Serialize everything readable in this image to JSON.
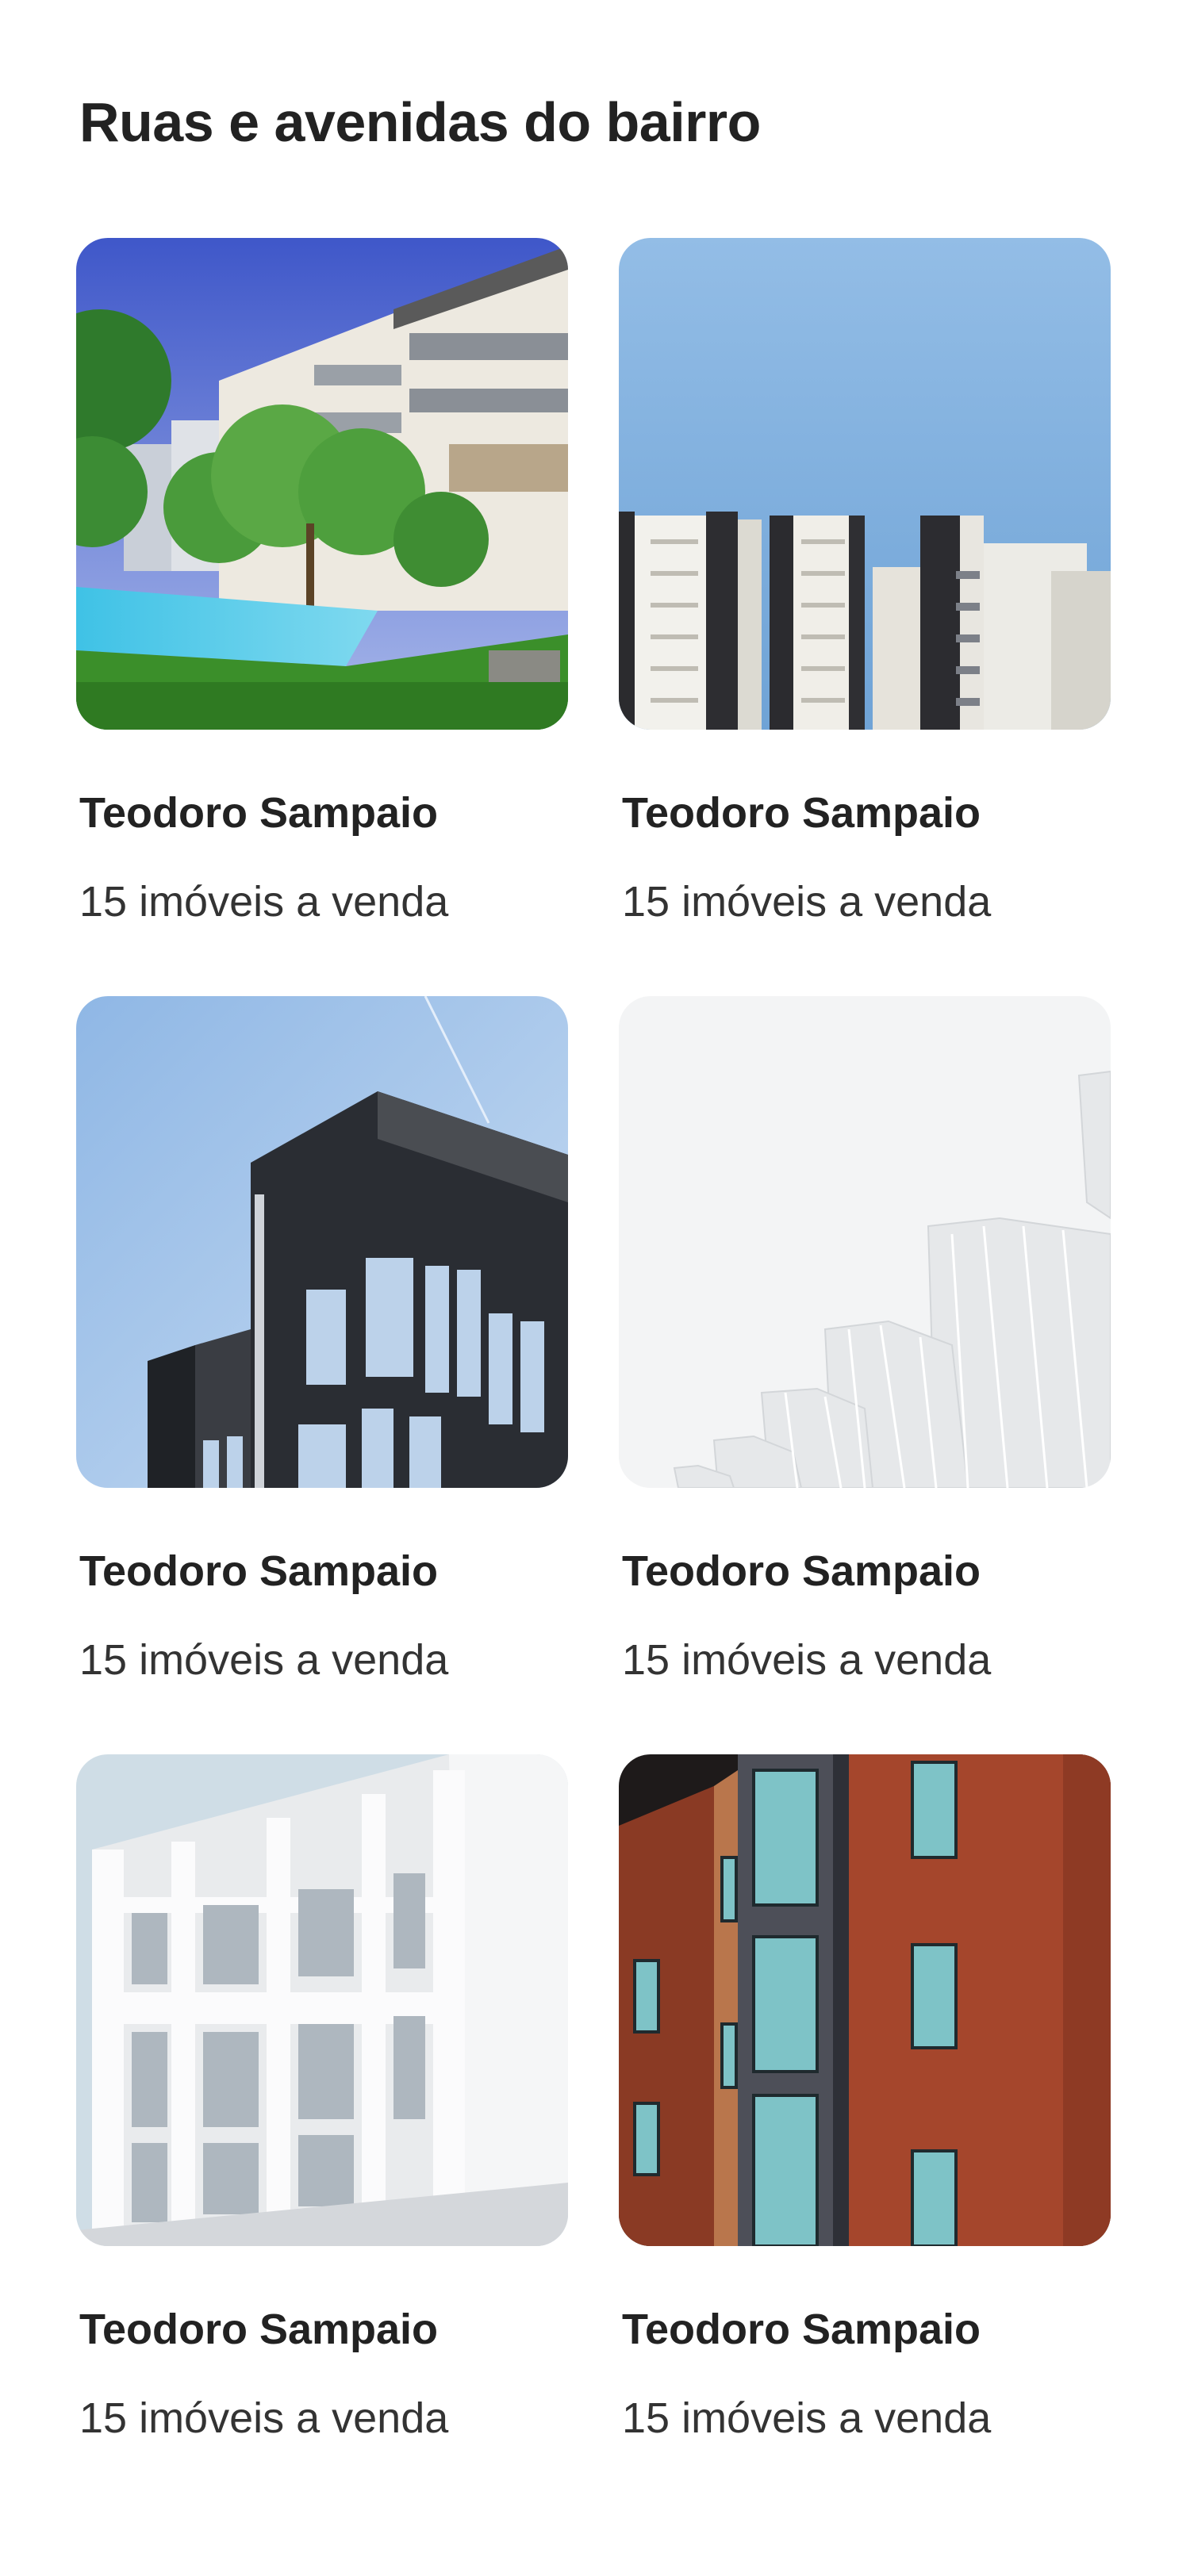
{
  "page": {
    "title": "Ruas e avenidas do bairro"
  },
  "streets": [
    {
      "name": "Teodoro Sampaio",
      "listings": "15 imóveis a venda",
      "image": "apartments-with-pool-photo"
    },
    {
      "name": "Teodoro Sampaio",
      "listings": "15 imóveis a venda",
      "image": "modern-towers-blue-sky-photo"
    },
    {
      "name": "Teodoro Sampaio",
      "listings": "15 imóveis a venda",
      "image": "dark-glass-building-photo"
    },
    {
      "name": "Teodoro Sampaio",
      "listings": "15 imóveis a venda",
      "image": "white-sculptural-fins-photo"
    },
    {
      "name": "Teodoro Sampaio",
      "listings": "15 imóveis a venda",
      "image": "white-facade-building-photo"
    },
    {
      "name": "Teodoro Sampaio",
      "listings": "15 imóveis a venda",
      "image": "red-brick-building-photo"
    }
  ]
}
